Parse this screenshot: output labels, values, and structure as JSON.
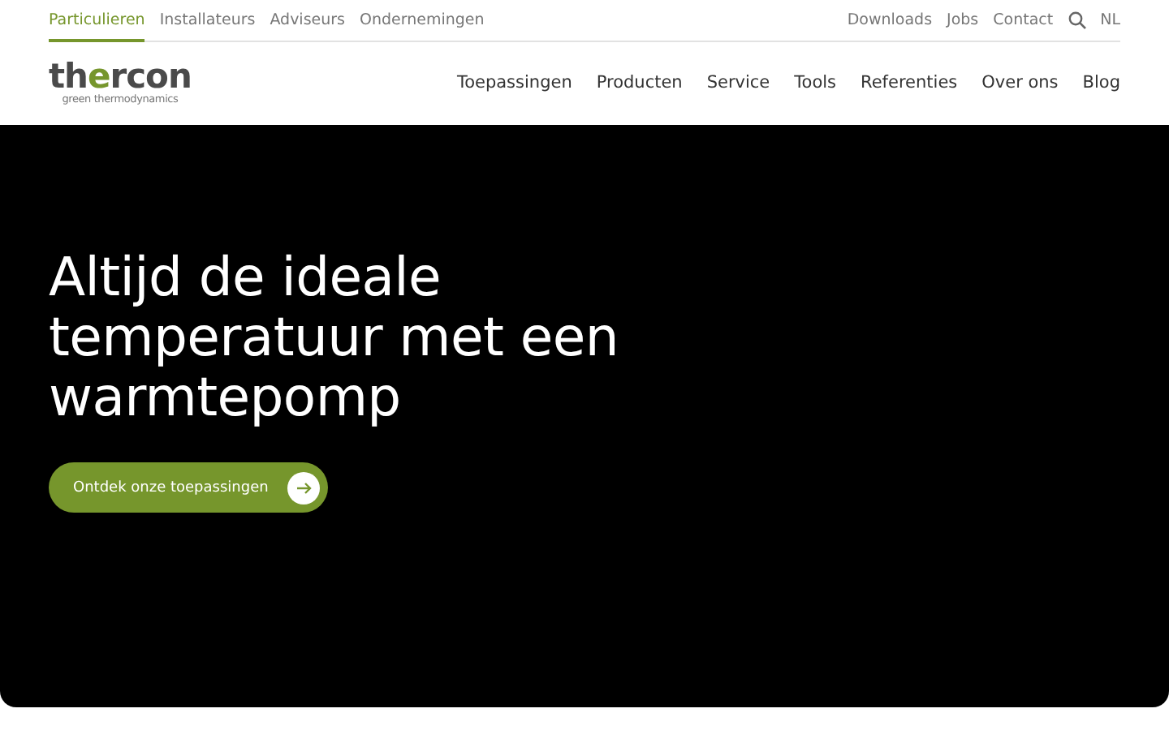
{
  "audience_tabs": [
    {
      "label": "Particulieren",
      "selected": true
    },
    {
      "label": "Installateurs",
      "selected": false
    },
    {
      "label": "Adviseurs",
      "selected": false
    },
    {
      "label": "Ondernemingen",
      "selected": false
    }
  ],
  "utility_links": [
    "Downloads",
    "Jobs",
    "Contact"
  ],
  "language": "NL",
  "logo": {
    "name": "thercon",
    "tagline": "green thermodynamics"
  },
  "main_nav": [
    "Toepassingen",
    "Producten",
    "Service",
    "Tools",
    "Referenties",
    "Over ons",
    "Blog"
  ],
  "hero": {
    "heading": "Altijd de ideale temperatuur met een warmtepomp",
    "button": "Ontdek onze toepassingen"
  }
}
